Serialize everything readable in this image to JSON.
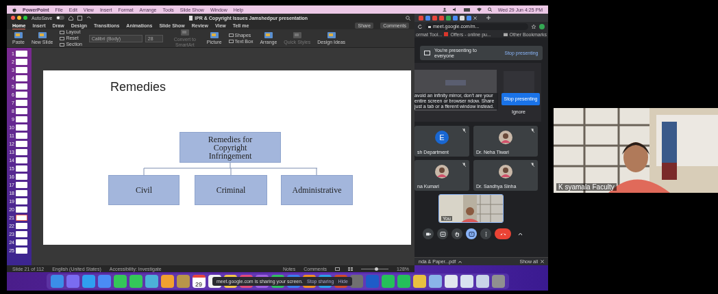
{
  "menu_bar": {
    "app": "PowerPoint",
    "items": [
      "File",
      "Edit",
      "View",
      "Insert",
      "Format",
      "Arrange",
      "Tools",
      "Slide Show",
      "Window",
      "Help"
    ],
    "clock": "Wed 29 Jun 4:25 PM"
  },
  "powerpoint": {
    "autosave": "AutoSave",
    "autosave_on": false,
    "title": "IPR & Copyright Issues Jamshedpur presentation",
    "tabs": [
      {
        "label": "Home",
        "selected": true
      },
      {
        "label": "Insert",
        "selected": false
      },
      {
        "label": "Draw",
        "selected": false
      },
      {
        "label": "Design",
        "selected": false
      },
      {
        "label": "Transitions",
        "selected": false
      },
      {
        "label": "Animations",
        "selected": false
      },
      {
        "label": "Slide Show",
        "selected": false
      },
      {
        "label": "Review",
        "selected": false
      },
      {
        "label": "View",
        "selected": false
      }
    ],
    "tell_me": "Tell me",
    "share": "Share",
    "comments": "Comments",
    "ribbon": [
      {
        "kind": "big",
        "label": "Paste",
        "disabled": false
      },
      {
        "kind": "big",
        "label": "New Slide",
        "disabled": false
      },
      {
        "kind": "stack",
        "items": [
          "Layout",
          "Reset",
          "Section"
        ]
      },
      {
        "kind": "font",
        "font": "Calibri (Body)",
        "size": "28"
      },
      {
        "kind": "big",
        "label": "Convert to SmartArt",
        "disabled": true
      },
      {
        "kind": "big",
        "label": "Picture",
        "disabled": false
      },
      {
        "kind": "stack",
        "items": [
          "Shapes",
          "Text Box"
        ]
      },
      {
        "kind": "big",
        "label": "Arrange",
        "disabled": false
      },
      {
        "kind": "big",
        "label": "Quick Styles",
        "disabled": true
      },
      {
        "kind": "big",
        "label": "Design Ideas",
        "disabled": false
      }
    ],
    "thumbnails": [
      {
        "number": "1",
        "selected": false
      },
      {
        "number": "2",
        "selected": false
      },
      {
        "number": "3",
        "selected": false
      },
      {
        "number": "4",
        "selected": false
      },
      {
        "number": "5",
        "selected": false
      },
      {
        "number": "6",
        "selected": false
      },
      {
        "number": "7",
        "selected": false
      },
      {
        "number": "8",
        "selected": false
      },
      {
        "number": "9",
        "selected": false
      },
      {
        "number": "10",
        "selected": false
      },
      {
        "number": "11",
        "selected": false
      },
      {
        "number": "12",
        "selected": false
      },
      {
        "number": "13",
        "selected": false
      },
      {
        "number": "14",
        "selected": false
      },
      {
        "number": "15",
        "selected": false
      },
      {
        "number": "16",
        "selected": false
      },
      {
        "number": "17",
        "selected": false
      },
      {
        "number": "18",
        "selected": false
      },
      {
        "number": "19",
        "selected": false
      },
      {
        "number": "20",
        "selected": false
      },
      {
        "number": "21",
        "selected": true
      },
      {
        "number": "22",
        "selected": false
      },
      {
        "number": "23",
        "selected": false
      },
      {
        "number": "24",
        "selected": false
      },
      {
        "number": "25",
        "selected": false
      }
    ],
    "slide": {
      "title": "Remedies",
      "root": "Remedies for Copyright Infringement",
      "children": [
        "Civil",
        "Criminal",
        "Administrative"
      ]
    },
    "status_bar": {
      "slide": "Slide 21 of 112",
      "language": "English (United States)",
      "accessibility": "Accessibility: Investigate",
      "notes": "Notes",
      "comments": "Comments",
      "zoom": {
        "level": 0.55,
        "reading": "128%"
      }
    }
  },
  "browser": {
    "address": "meet.google.com/m...",
    "bookmarks": [
      "ormat Tool...",
      "Offers - online pu..."
    ],
    "other_bookmarks": "Other Bookmarks",
    "download": "nda & Paper...pdf",
    "show_all": "Show all"
  },
  "meet": {
    "banner": "You're presenting to everyone",
    "banner_action": "Stop presenting",
    "warning": "avoid an infinity mirror, don't are your entire screen or browser ndow. Share just a tab or a fferent window instead.",
    "stop": "Stop presenting",
    "ignore": "Ignore",
    "participants": [
      {
        "kind": "letter",
        "letter": "E",
        "name": "sh Department"
      },
      {
        "name": "Dr. Neha Tiwari"
      },
      {
        "name": "na Kumari"
      },
      {
        "name": "Dr. Sandhya Sinha"
      }
    ],
    "self": "You",
    "controls": [
      {
        "kind": "camera"
      },
      {
        "kind": "captions"
      },
      {
        "kind": "hand"
      },
      {
        "kind": "present"
      },
      {
        "kind": "more"
      },
      {
        "kind": "hangup"
      },
      {
        "kind": "caret"
      }
    ]
  },
  "dock": {
    "calendar_day": "29",
    "notification": {
      "text": "meet.google.com is sharing your screen.",
      "stop": "Stop sharing",
      "hide": "Hide"
    }
  },
  "camera": {
    "name": "K syamala Faculty"
  }
}
